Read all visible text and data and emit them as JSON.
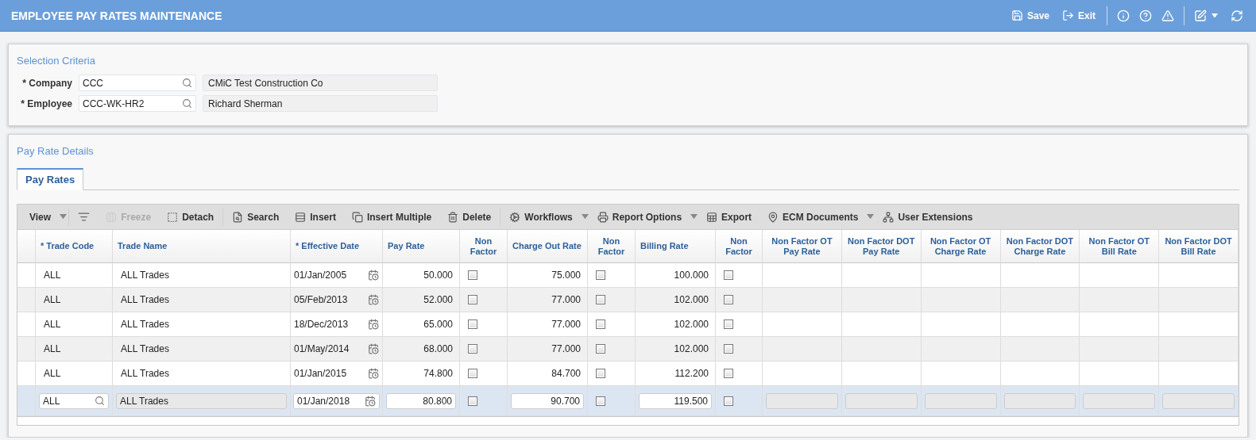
{
  "header": {
    "title": "EMPLOYEE PAY RATES MAINTENANCE",
    "actions": [
      {
        "kind": "save",
        "label": "Save"
      },
      {
        "kind": "exit",
        "label": "Exit"
      }
    ]
  },
  "selection": {
    "title": "Selection Criteria",
    "fields": [
      {
        "label": "* Company",
        "value": "CCC",
        "description": "CMiC Test Construction Co"
      },
      {
        "label": "* Employee",
        "value": "CCC-WK-HR2",
        "description": "Richard Sherman"
      }
    ]
  },
  "details": {
    "title": "Pay Rate Details",
    "tabs": [
      {
        "label": "Pay Rates",
        "selected": true
      }
    ],
    "toolbar": [
      {
        "kind": "menu",
        "label": "View",
        "disabled": false
      },
      {
        "kind": "icon",
        "disabled": false
      },
      {
        "kind": "button",
        "label": "Freeze",
        "disabled": true
      },
      {
        "kind": "button",
        "label": "Detach",
        "disabled": false
      },
      {
        "kind": "button",
        "label": "Search",
        "disabled": false
      },
      {
        "kind": "button",
        "label": "Insert",
        "disabled": false
      },
      {
        "kind": "button",
        "label": "Insert Multiple",
        "disabled": false
      },
      {
        "kind": "button",
        "label": "Delete",
        "disabled": false
      },
      {
        "kind": "menu",
        "label": "Workflows",
        "disabled": false
      },
      {
        "kind": "menu",
        "label": "Report Options",
        "disabled": false
      },
      {
        "kind": "button",
        "label": "Export",
        "disabled": false
      },
      {
        "kind": "menu",
        "label": "ECM Documents",
        "disabled": false
      },
      {
        "kind": "button",
        "label": "User Extensions",
        "disabled": false
      }
    ],
    "table": {
      "columns": [
        {
          "label": "* Trade Code",
          "kind": "code"
        },
        {
          "label": "Trade Name",
          "kind": "name"
        },
        {
          "label": "* Effective Date",
          "kind": "date"
        },
        {
          "label": "Pay Rate",
          "kind": "number"
        },
        {
          "label": "Non Factor",
          "kind": "check"
        },
        {
          "label": "Charge Out Rate",
          "kind": "number"
        },
        {
          "label": "Non Factor",
          "kind": "check"
        },
        {
          "label": "Billing Rate",
          "kind": "number"
        },
        {
          "label": "Non Factor",
          "kind": "check"
        },
        {
          "label": "Non Factor OT Pay Rate",
          "kind": "empty"
        },
        {
          "label": "Non Factor DOT Pay Rate",
          "kind": "empty"
        },
        {
          "label": "Non Factor OT Charge Rate",
          "kind": "empty"
        },
        {
          "label": "Non Factor DOT Charge Rate",
          "kind": "empty"
        },
        {
          "label": "Non Factor OT Bill Rate",
          "kind": "empty"
        },
        {
          "label": "Non Factor DOT Bill Rate",
          "kind": "empty"
        }
      ],
      "rows": [
        {
          "selected": false,
          "cells": [
            "ALL",
            "ALL Trades",
            "01/Jan/2005",
            "50.000",
            false,
            "75.000",
            false,
            "100.000",
            false
          ]
        },
        {
          "selected": false,
          "cells": [
            "ALL",
            "ALL Trades",
            "05/Feb/2013",
            "52.000",
            false,
            "77.000",
            false,
            "102.000",
            false
          ]
        },
        {
          "selected": false,
          "cells": [
            "ALL",
            "ALL Trades",
            "18/Dec/2013",
            "65.000",
            false,
            "77.000",
            false,
            "102.000",
            false
          ]
        },
        {
          "selected": false,
          "cells": [
            "ALL",
            "ALL Trades",
            "01/May/2014",
            "68.000",
            false,
            "77.000",
            false,
            "102.000",
            false
          ]
        },
        {
          "selected": false,
          "cells": [
            "ALL",
            "ALL Trades",
            "01/Jan/2015",
            "74.800",
            false,
            "84.700",
            false,
            "112.200",
            false
          ]
        },
        {
          "selected": true,
          "cells": [
            "ALL",
            "ALL Trades",
            "01/Jan/2018",
            "80.800",
            false,
            "90.700",
            false,
            "119.500",
            false
          ]
        }
      ]
    }
  }
}
